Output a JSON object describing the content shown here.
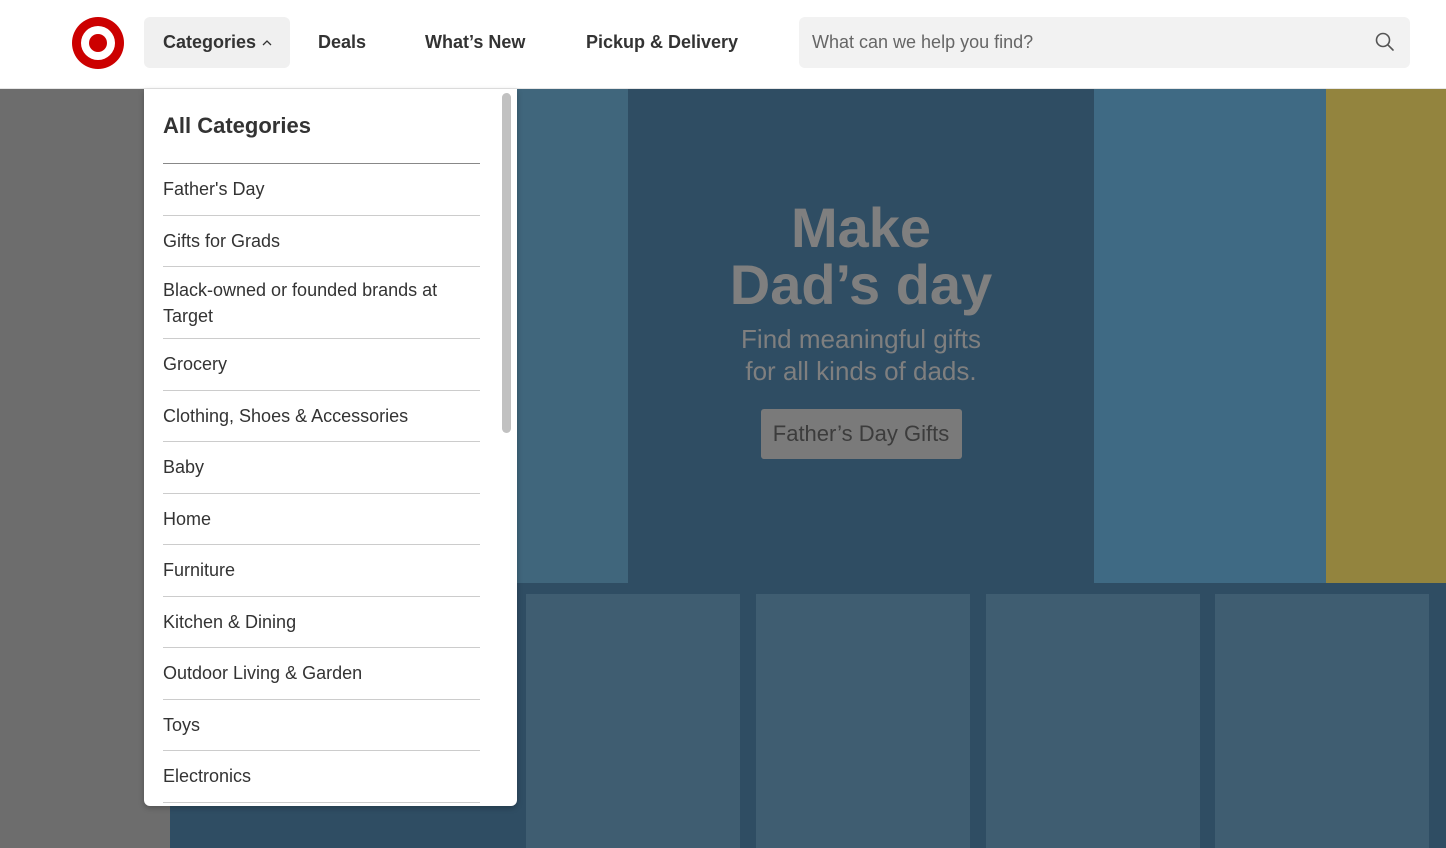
{
  "header": {
    "logo_icon": "target-bullseye-icon",
    "brand_color": "#cc0000",
    "nav": {
      "categories": "Categories",
      "deals": "Deals",
      "whats_new": "What’s New",
      "pickup_delivery": "Pickup & Delivery"
    },
    "search": {
      "placeholder": "What can we help you find?",
      "icon": "search-icon"
    }
  },
  "menu": {
    "title": "All Categories",
    "items": [
      "Father's Day",
      "Gifts for Grads",
      "Black-owned or founded brands at Target",
      "Grocery",
      "Clothing, Shoes & Accessories",
      "Baby",
      "Home",
      "Furniture",
      "Kitchen & Dining",
      "Outdoor Living & Garden",
      "Toys",
      "Electronics"
    ]
  },
  "hero": {
    "title_line1": "Make",
    "title_line2": "Dad’s day",
    "subtitle_line1": "Find meaningful gifts",
    "subtitle_line2": "for all kinds of dads.",
    "cta": "Father’s Day Gifts"
  },
  "colors": {
    "overlay": "#6d6d6d",
    "hero_bg": "#2f4d63",
    "menu_bg": "#ffffff"
  }
}
